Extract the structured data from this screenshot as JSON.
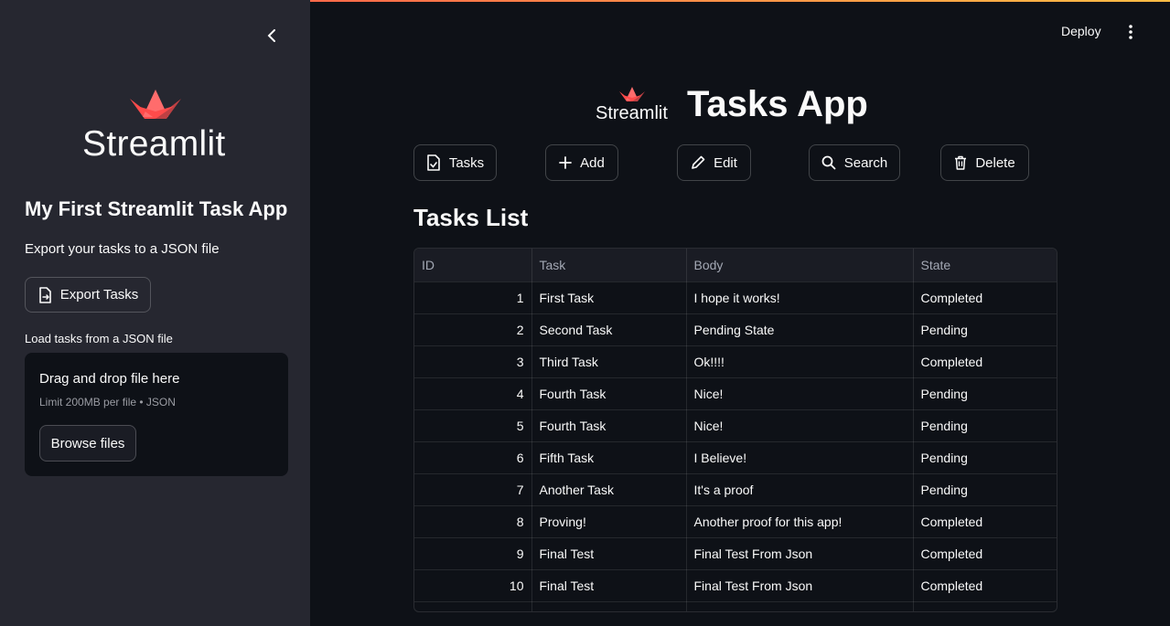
{
  "colors": {
    "accent": "#ff4b4b",
    "background": "#0e1117",
    "sidebar": "#262730"
  },
  "sidebar": {
    "logo_text": "Streamlit",
    "title": "My First Streamlit Task App",
    "export_text": "Export your tasks to a JSON file",
    "export_button": "Export Tasks",
    "load_label": "Load tasks from a JSON file",
    "uploader": {
      "title": "Drag and drop file here",
      "limit": "Limit 200MB per file • JSON",
      "browse_button": "Browse files"
    }
  },
  "header": {
    "deploy": "Deploy"
  },
  "main": {
    "logo_text": "Streamlit",
    "title": "Tasks App",
    "actions": [
      {
        "label": "Tasks",
        "icon": "file-check-icon"
      },
      {
        "label": "Add",
        "icon": "plus-icon"
      },
      {
        "label": "Edit",
        "icon": "pencil-icon"
      },
      {
        "label": "Search",
        "icon": "search-icon"
      },
      {
        "label": "Delete",
        "icon": "trash-icon"
      }
    ],
    "section_title": "Tasks List",
    "table": {
      "columns": [
        "ID",
        "Task",
        "Body",
        "State"
      ],
      "rows": [
        [
          "1",
          "First Task",
          "I hope it works!",
          "Completed"
        ],
        [
          "2",
          "Second Task",
          "Pending State",
          "Pending"
        ],
        [
          "3",
          "Third Task",
          "Ok!!!!",
          "Completed"
        ],
        [
          "4",
          "Fourth Task",
          "Nice!",
          "Pending"
        ],
        [
          "5",
          "Fourth Task",
          "Nice!",
          "Pending"
        ],
        [
          "6",
          "Fifth Task",
          "I Believe!",
          "Pending"
        ],
        [
          "7",
          "Another Task",
          "It's a proof",
          "Pending"
        ],
        [
          "8",
          "Proving!",
          "Another proof for this app!",
          "Completed"
        ],
        [
          "9",
          "Final Test",
          "Final Test From Json",
          "Completed"
        ],
        [
          "10",
          "Final Test",
          "Final Test From Json",
          "Completed"
        ]
      ]
    }
  }
}
